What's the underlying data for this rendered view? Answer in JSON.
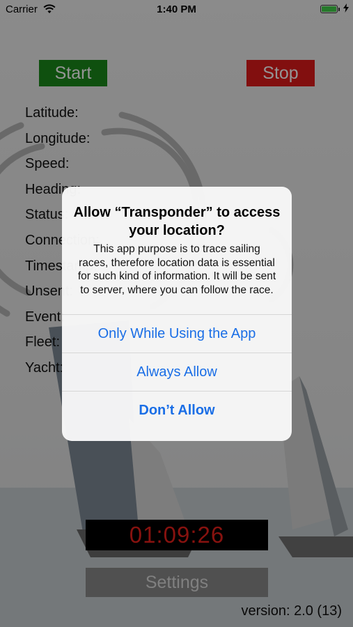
{
  "status_bar": {
    "carrier": "Carrier",
    "time": "1:40 PM",
    "battery_level": 1.0
  },
  "controls": {
    "start_label": "Start",
    "stop_label": "Stop",
    "settings_label": "Settings"
  },
  "info_labels": [
    "Latitude:",
    "Longitude:",
    "Speed:",
    "Heading:",
    "Status:",
    "Connection:",
    "Timestamp:",
    "Unsent:",
    "Event:",
    "Fleet:",
    "Yacht:"
  ],
  "clock": {
    "value": "01:09:26"
  },
  "version": "version: 2.0 (13)",
  "alert": {
    "title": "Allow “Transponder” to access your location?",
    "message": "This app purpose is to trace sailing races, therefore location data is essential for such kind of information. It will be sent to server, where you can follow the race.",
    "buttons": [
      {
        "label": "Only While Using the App"
      },
      {
        "label": "Always Allow"
      },
      {
        "label": "Don’t Allow"
      }
    ]
  },
  "colors": {
    "start": "#1a8a1a",
    "stop": "#e01a1a",
    "clock_text": "#e8201a",
    "alert_button": "#1a6ee6"
  },
  "icons": [
    "wifi-icon",
    "battery-icon",
    "charging-bolt-icon",
    "transponder-waves-icon"
  ]
}
